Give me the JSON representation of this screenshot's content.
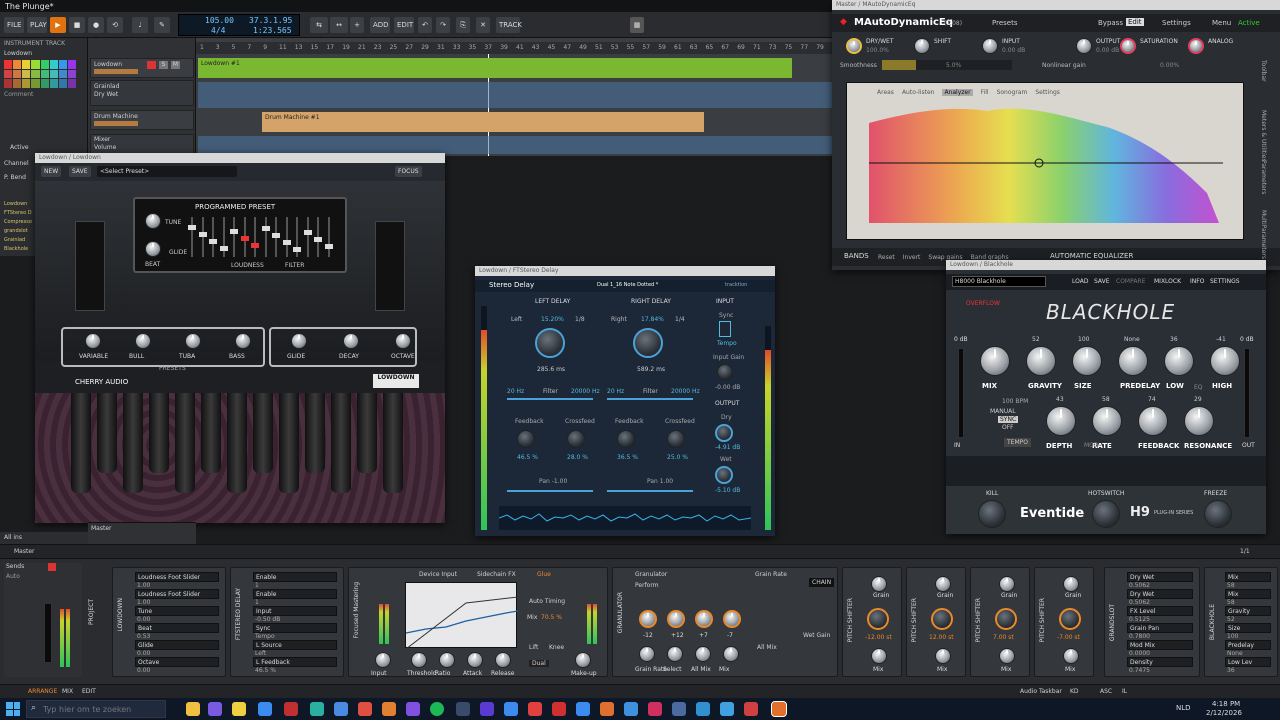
{
  "window_title": "The Plunge*",
  "toolbar": {
    "file": "FILE",
    "play": "PLAY",
    "add": "ADD",
    "edit": "EDIT",
    "track": "TRACK",
    "tempo": "105.00",
    "timesig": "4/4",
    "position": "37.3.1.95",
    "time": "1:23.565"
  },
  "left_panel": {
    "header": "INSTRUMENT TRACK",
    "track_name": "Lowdown",
    "comment": "Comment",
    "active": "Active",
    "channel": "Channel",
    "channel_value": "All",
    "pbend": "P. Bend",
    "fx_list": [
      "Lowdown",
      "FTStereo D",
      "Compresso",
      "grandslot",
      "Grainlad",
      "Blackhole"
    ]
  },
  "tracks": [
    {
      "name": "Lowdown"
    },
    {
      "name": "Grainlad",
      "sub": "Dry Wet"
    },
    {
      "name": "Drum Machine"
    },
    {
      "name": "Mixer",
      "sub": "Volume"
    }
  ],
  "ruler": [
    "1",
    "3",
    "5",
    "7",
    "9",
    "11",
    "13",
    "15",
    "17",
    "19",
    "21",
    "23",
    "25",
    "27",
    "29",
    "31",
    "33",
    "35",
    "37",
    "39",
    "41",
    "43",
    "45",
    "47",
    "49",
    "51",
    "53",
    "55",
    "57",
    "59",
    "61",
    "63",
    "65",
    "67",
    "69",
    "71",
    "73",
    "75",
    "77",
    "79"
  ],
  "clips": {
    "lowdown": "Lowdown #1",
    "drum": "Drum Machine #1"
  },
  "lowdown_plugin": {
    "window_title": "Lowdown / Lowdown",
    "new": "NEW",
    "save": "SAVE",
    "preset": "<Select Preset>",
    "focus": "FOCUS",
    "programmed": "PROGRAMMED PRESET",
    "tune": "TUNE",
    "beat": "BEAT",
    "glide": "GLIDE",
    "loudness": "LOUDNESS",
    "filter": "FILTER",
    "knobs1": [
      "VARIABLE",
      "BULL",
      "TUBA",
      "BASS"
    ],
    "presets": "PRESETS",
    "knobs2": [
      "GLIDE",
      "DECAY",
      "OCTAVE"
    ],
    "brand": "CHERRY AUDIO",
    "logo": "LOWDOWN",
    "logo_sub": "Bass Synthesizer"
  },
  "stereo_delay": {
    "window_title": "Lowdown / FTStereo Delay",
    "name": "Stereo Delay",
    "preset": "Dual 1_16 Note Dotted *",
    "brand": "tracktion",
    "left_delay": "LEFT DELAY",
    "right_delay": "RIGHT DELAY",
    "input": "INPUT",
    "left": "Left",
    "right": "Right",
    "left_pct": "15.20%",
    "right_pct": "17.84%",
    "left_div": "1/8",
    "right_div": "1/4",
    "left_ms": "285.6 ms",
    "right_ms": "589.2 ms",
    "sync": "Sync",
    "tempo": "Tempo",
    "input_gain": "Input Gain",
    "input_gain_val": "-0.00 dB",
    "hz_lo": "20 Hz",
    "hz_hi": "20000 Hz",
    "filter": "Filter",
    "output": "OUTPUT",
    "dry": "Dry",
    "dry_val": "-4.91 dB",
    "wet": "Wet",
    "wet_val": "-5.10 dB",
    "feedback": "Feedback",
    "crossfeed": "Crossfeed",
    "fb_l": "46.5 %",
    "cf_l": "28.0 %",
    "fb_r": "36.5 %",
    "cf_r": "25.0 %",
    "pan_l": "Pan -1.00",
    "pan_r": "Pan 1.00"
  },
  "mauto": {
    "window_title": "Master / MAutoDynamicEq",
    "name": "MAutoDynamicEq",
    "version": "(7.08)",
    "presets": "Presets",
    "bypass": "Bypass",
    "edit": "Edit",
    "settings": "Settings",
    "menu": "Menu",
    "active": "Active",
    "drywet": "DRY/WET",
    "drywet_val": "100.0%",
    "shift": "SHIFT",
    "input": "INPUT",
    "input_val": "0.00 dB",
    "output": "OUTPUT",
    "output_val": "0.00 dB",
    "saturation": "SATURATION",
    "analog": "ANALOG",
    "smoothness": "Smoothness",
    "smooth_val": "5.0%",
    "nonlinear": "Nonlinear gain",
    "nonlinear_val": "0.00%",
    "tabs": [
      "Areas",
      "Auto-listen",
      "Analyzer",
      "Fill",
      "Sonogram",
      "Settings"
    ],
    "bands": "BANDS",
    "band_btns": [
      "Reset",
      "Invert",
      "Swap gains",
      "Band graphs"
    ],
    "auto_eq": "AUTOMATIC EQUALIZER",
    "side": [
      "Toolbar",
      "Meters & Utilities",
      "Parameters",
      "MultiParameters"
    ]
  },
  "blackhole": {
    "window_title": "Lowdown / Blackhole",
    "preset": "H8000 Blackhole",
    "load": "LOAD",
    "save": "SAVE",
    "compare": "COMPARE",
    "mixlock": "MIXLOCK",
    "info": "INFO",
    "settings": "SETTINGS",
    "overflow": "OVERFLOW",
    "logo": "BLACKHOLE",
    "db_left": "0 dB",
    "db_right": "0 dB",
    "row1": [
      {
        "label": "MIX",
        "val": ""
      },
      {
        "label": "GRAVITY",
        "val": "52"
      },
      {
        "label": "SIZE",
        "val": "100"
      },
      {
        "label": "PREDELAY",
        "val": "None"
      },
      {
        "label": "LOW",
        "val": "36"
      },
      {
        "label": "HIGH",
        "val": "-41"
      }
    ],
    "eq": "EQ",
    "bpm": "100 BPM",
    "manual": "MANUAL",
    "sync": "SYNC",
    "off": "OFF",
    "tempo": "TEMPO",
    "row2": [
      {
        "label": "DEPTH",
        "val": "43"
      },
      {
        "label": "RATE",
        "val": "58"
      },
      {
        "label": "FEEDBACK",
        "val": "74"
      },
      {
        "label": "RESONANCE",
        "val": "29"
      }
    ],
    "mod": "MOD",
    "in": "IN",
    "out": "OUT",
    "kill": "KILL",
    "hotswitch": "HOTSWITCH",
    "freeze": "FREEZE",
    "brand": "Eventide",
    "h9": "H9",
    "h9_sub": "PLUG-IN SERIES"
  },
  "arranger_footer": {
    "all_ins": "All ins",
    "master": "Master",
    "master2": "Master",
    "page": "1/1"
  },
  "dock": {
    "sends": "Sends",
    "auto": "Auto",
    "project": "PROJECT",
    "lowdown": "LOWDOWN",
    "lowdown_params": [
      {
        "k": "Loudness Foot Slider",
        "v": "1.00"
      },
      {
        "k": "Loudness Foot Slider",
        "v": "1.00"
      },
      {
        "k": "Tune",
        "v": "0.00"
      },
      {
        "k": "Beat",
        "v": "0.53"
      },
      {
        "k": "Glide",
        "v": "0.00"
      },
      {
        "k": "Octave",
        "v": "0.00"
      }
    ],
    "ftstereo": "FTSTEREO DELAY",
    "ftstereo_params": [
      {
        "k": "Enable",
        "v": "1"
      },
      {
        "k": "Enable",
        "v": "1"
      },
      {
        "k": "Input",
        "v": "-0.50 dB"
      },
      {
        "k": "Sync",
        "v": "Tempo"
      },
      {
        "k": "L Source",
        "v": "Left"
      },
      {
        "k": "L Feedback",
        "v": "46.5 %"
      }
    ],
    "focused": "Focused Mastering",
    "device_input": "Device Input",
    "sidechain": "Sidechain FX",
    "glue": "Glue",
    "comp_knobs": [
      "Input",
      "Threshold",
      "Ratio",
      "Attack",
      "Release",
      "Make-up"
    ],
    "auto_timing": "Auto Timing",
    "mix": "Mix",
    "mix_val": "70.5 %",
    "lift": "Lift",
    "knee": "Knee",
    "dual": "Dual",
    "granulator": "GRANULATOR",
    "granulator_hdr": "Granulator",
    "perform": "Perform",
    "grain_rate": "Grain Rate",
    "chain": "CHAIN",
    "gran_vals": [
      "-12",
      "+12",
      "+7",
      "-7"
    ],
    "gran_knobs": [
      "Grain Rate",
      "Select",
      "All Mix",
      "Mix"
    ],
    "all_mix": "All Mix",
    "wet_gain": "Wet Gain",
    "pitch_shifter": "PITCH SHIFTER",
    "pitch": [
      {
        "grain": "Grain",
        "val": "-12.00 st",
        "mix": "Mix"
      },
      {
        "grain": "Grain",
        "val": "12.00 st",
        "mix": "Mix"
      },
      {
        "grain": "Grain",
        "val": "7.00 st",
        "mix": "Mix"
      },
      {
        "grain": "Grain",
        "val": "-7.00 st",
        "mix": "Mix"
      }
    ],
    "grandslot": "GRANDSLOT",
    "grand_params": [
      {
        "k": "Dry Wet",
        "v": "0.5062"
      },
      {
        "k": "Dry Wet",
        "v": "0.5062"
      },
      {
        "k": "FX Level",
        "v": "0.5125"
      },
      {
        "k": "Grain Pan",
        "v": "0.7800"
      },
      {
        "k": "Mod Mix",
        "v": "0.0000"
      },
      {
        "k": "Density",
        "v": "0.7475"
      }
    ],
    "blackhole": "BLACKHOLE",
    "bh_params": [
      {
        "k": "Mix",
        "v": "58"
      },
      {
        "k": "Mix",
        "v": "58"
      },
      {
        "k": "Gravity",
        "v": "52"
      },
      {
        "k": "Size",
        "v": "100"
      },
      {
        "k": "Predelay",
        "v": "None"
      },
      {
        "k": "Low Lev",
        "v": "36"
      }
    ]
  },
  "status": {
    "arrange": "ARRANGE",
    "mix": "MIX",
    "edit": "EDIT",
    "audio": "Audio Taskbar",
    "kd": "KD",
    "asc": "ASC",
    "il": "IL"
  },
  "taskbar": {
    "search_placeholder": "Typ hier om te zoeken",
    "lang": "NLD",
    "time": "4:18 PM",
    "date": "2/12/2026"
  }
}
